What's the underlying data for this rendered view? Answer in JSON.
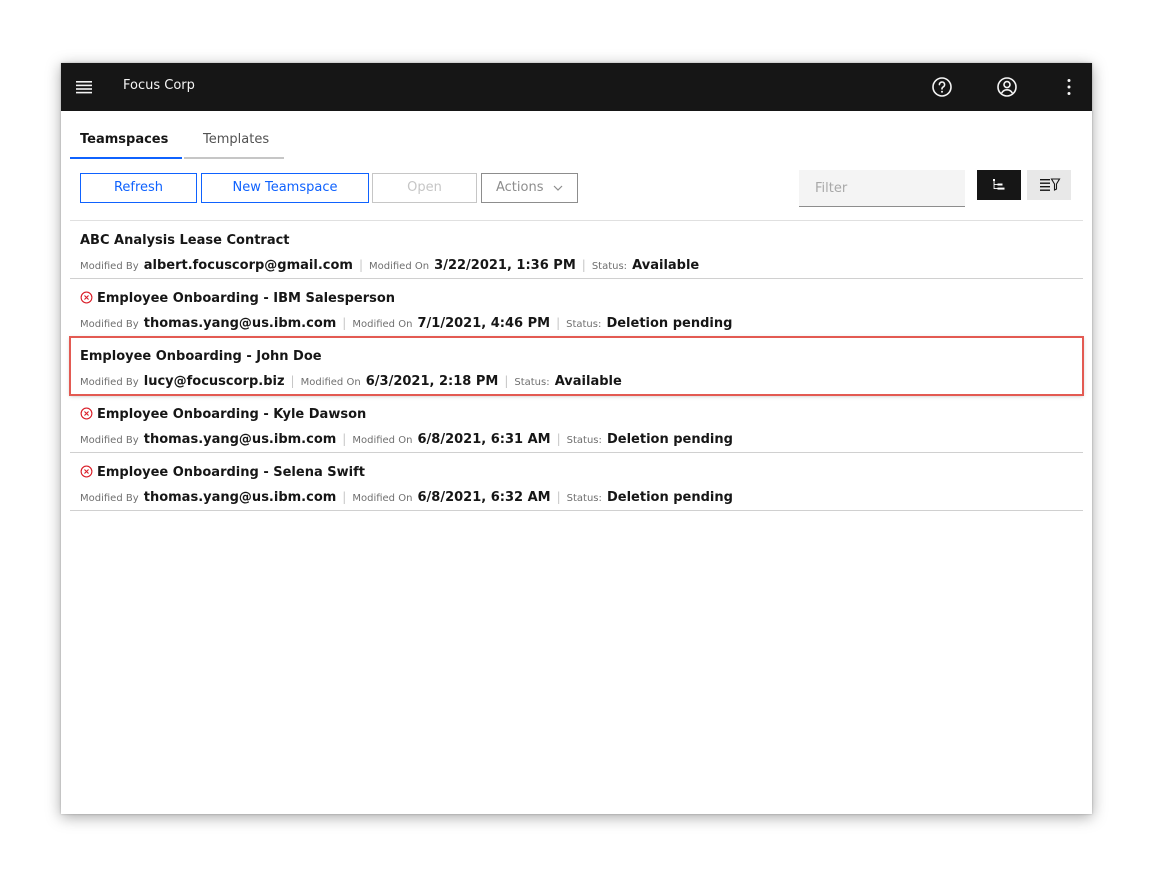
{
  "app": {
    "name": "Focus Corp"
  },
  "header": {
    "icons": [
      "menu-icon",
      "help-icon",
      "user-icon",
      "overflow-menu-icon"
    ]
  },
  "tabs": [
    {
      "label": "Teamspaces",
      "active": true
    },
    {
      "label": "Templates",
      "active": false
    }
  ],
  "toolbar": {
    "refresh_label": "Refresh",
    "new_teamspace_label": "New Teamspace",
    "open_label": "Open",
    "actions_label": "Actions",
    "filter_placeholder": "Filter"
  },
  "list": {
    "labels": {
      "modified_by": "Modified By",
      "modified_on": "Modified On",
      "status": "Status:"
    },
    "items": [
      {
        "title": "ABC Analysis Lease Contract",
        "modified_by": "albert.focuscorp@gmail.com",
        "modified_on": "3/22/2021, 1:36 PM",
        "status": "Available",
        "error": false,
        "selected": false
      },
      {
        "title": "Employee Onboarding - IBM Salesperson",
        "modified_by": "thomas.yang@us.ibm.com",
        "modified_on": "7/1/2021, 4:46 PM",
        "status": "Deletion pending",
        "error": true,
        "selected": false
      },
      {
        "title": "Employee Onboarding - John Doe",
        "modified_by": "lucy@focuscorp.biz",
        "modified_on": "6/3/2021, 2:18 PM",
        "status": "Available",
        "error": false,
        "selected": true
      },
      {
        "title": "Employee Onboarding - Kyle Dawson",
        "modified_by": "thomas.yang@us.ibm.com",
        "modified_on": "6/8/2021, 6:31 AM",
        "status": "Deletion pending",
        "error": true,
        "selected": false
      },
      {
        "title": "Employee Onboarding - Selena Swift",
        "modified_by": "thomas.yang@us.ibm.com",
        "modified_on": "6/8/2021, 6:32 AM",
        "status": "Deletion pending",
        "error": true,
        "selected": false
      }
    ]
  },
  "colors": {
    "header_bg": "#161616",
    "accent": "#0f62fe",
    "error": "#da1e28",
    "selection": "#e35a52"
  }
}
